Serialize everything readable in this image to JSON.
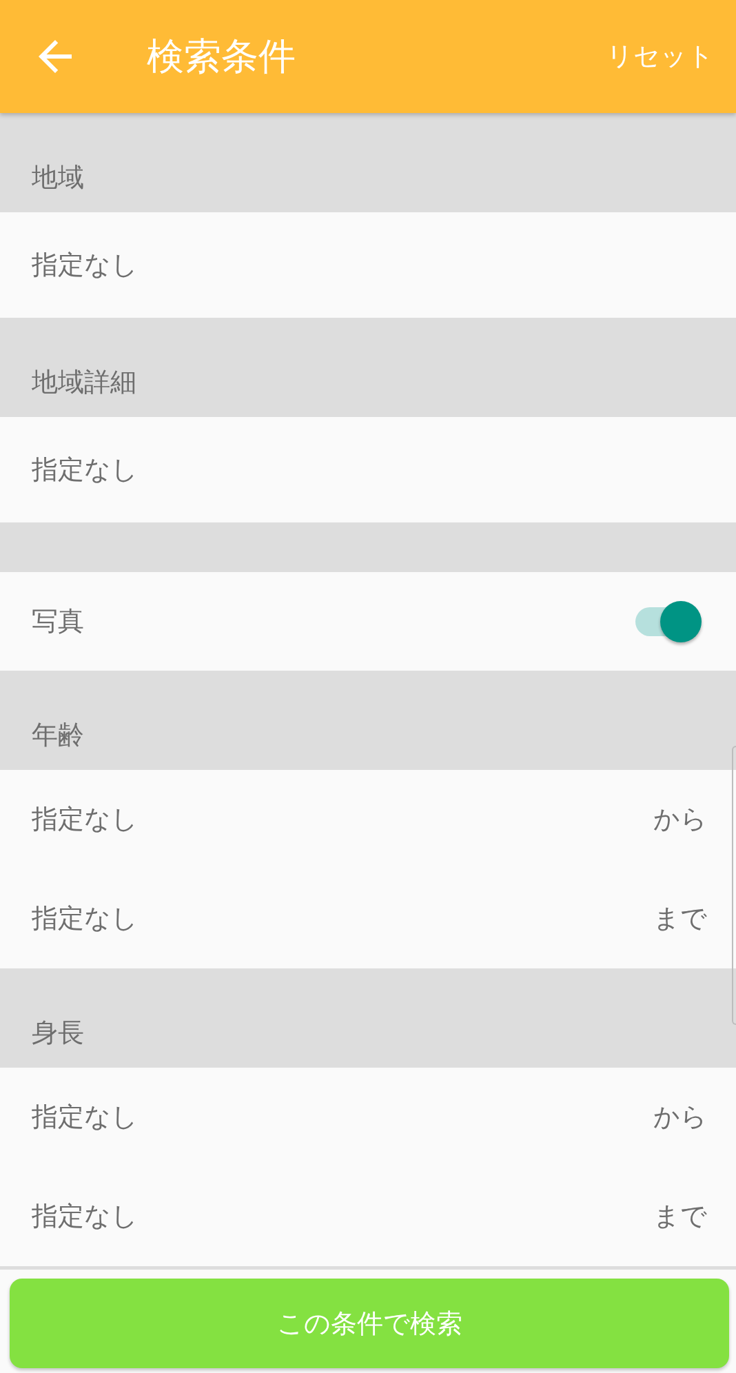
{
  "app_bar": {
    "title": "検索条件",
    "reset": "リセット"
  },
  "sections": [
    {
      "heading": "地域",
      "rows": [
        {
          "kind": "select",
          "value": "指定なし"
        }
      ]
    },
    {
      "heading": "地域詳細",
      "rows": [
        {
          "kind": "select",
          "value": "指定なし"
        }
      ]
    },
    {
      "rows": [
        {
          "kind": "switch",
          "label": "写真",
          "on": true
        }
      ]
    },
    {
      "heading": "年齢",
      "rows": [
        {
          "kind": "range",
          "value": "指定なし",
          "suffix": "から"
        },
        {
          "kind": "range",
          "value": "指定なし",
          "suffix": "まで"
        }
      ]
    },
    {
      "heading": "身長",
      "rows": [
        {
          "kind": "range",
          "value": "指定なし",
          "suffix": "から"
        },
        {
          "kind": "range",
          "value": "指定なし",
          "suffix": "まで"
        }
      ]
    }
  ],
  "search_button": {
    "label": "この条件で検索"
  }
}
